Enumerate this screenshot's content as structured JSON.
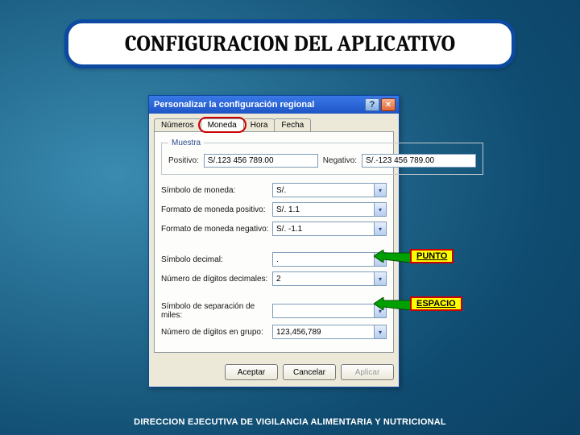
{
  "slide": {
    "title": "CONFIGURACION DEL APLICATIVO",
    "footer": "DIRECCION EJECUTIVA DE VIGILANCIA ALIMENTARIA Y NUTRICIONAL"
  },
  "dialog": {
    "title": "Personalizar la configuración regional",
    "help_glyph": "?",
    "close_glyph": "×",
    "tabs": [
      "Números",
      "Moneda",
      "Hora",
      "Fecha"
    ],
    "active_tab": "Moneda",
    "muestra_legend": "Muestra",
    "positivo_label": "Positivo:",
    "positivo_value": "S/.123 456 789.00",
    "negativo_label": "Negativo:",
    "negativo_value": "S/.-123 456 789.00",
    "fields": {
      "simbolo_moneda": {
        "label": "Símbolo de moneda:",
        "value": "S/."
      },
      "formato_moneda_pos": {
        "label": "Formato de moneda positivo:",
        "value": "S/. 1.1"
      },
      "formato_moneda_neg": {
        "label": "Formato de moneda negativo:",
        "value": "S/. -1.1"
      },
      "simbolo_decimal": {
        "label": "Símbolo decimal:",
        "value": "."
      },
      "digitos_decimales": {
        "label": "Número de dígitos decimales:",
        "value": "2"
      },
      "separador_miles": {
        "label": "Símbolo de separación de miles:",
        "value": " "
      },
      "digitos_grupo": {
        "label": "Número de dígitos en grupo:",
        "value": "123,456,789"
      }
    },
    "buttons": {
      "aceptar": "Aceptar",
      "cancelar": "Cancelar",
      "aplicar": "Aplicar"
    }
  },
  "callouts": {
    "punto": "PUNTO",
    "espacio": "ESPACIO"
  }
}
